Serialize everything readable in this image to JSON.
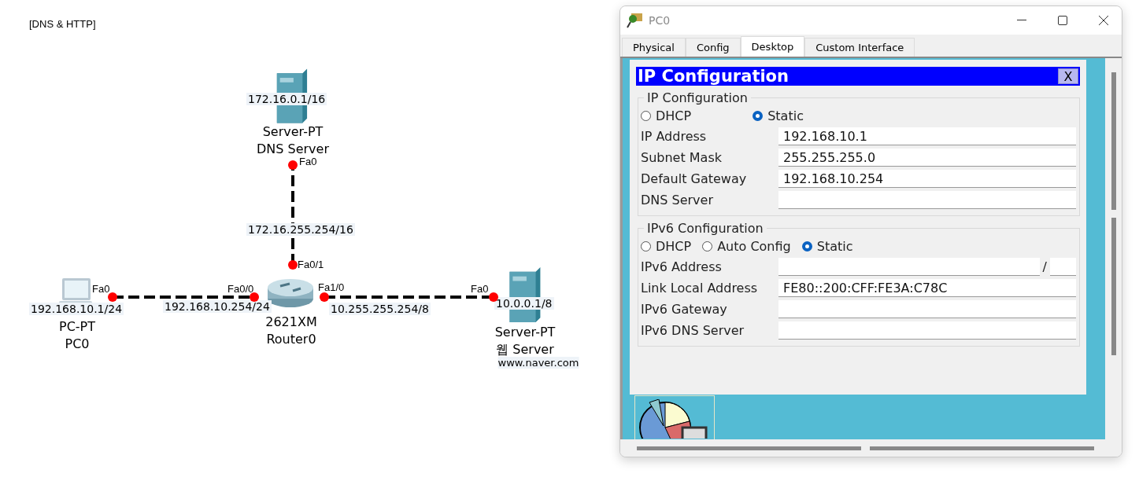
{
  "canvas": {
    "title": "[DNS & HTTP]",
    "devices": [
      {
        "kind": "server",
        "model": "Server-PT",
        "name": "DNS Server",
        "interfaces": [
          {
            "port": "Fa0",
            "address": "172.16.0.1/16"
          }
        ]
      },
      {
        "kind": "pc",
        "model": "PC-PT",
        "name": "PC0",
        "interfaces": [
          {
            "port": "Fa0",
            "address": "192.168.10.1/24"
          }
        ]
      },
      {
        "kind": "router",
        "model": "2621XM",
        "name": "Router0",
        "interfaces": [
          {
            "port": "Fa0/0",
            "address": "192.168.10.254/24"
          },
          {
            "port": "Fa0/1",
            "address": "172.16.255.254/16"
          },
          {
            "port": "Fa1/0",
            "address": "10.255.255.254/8"
          }
        ]
      },
      {
        "kind": "server",
        "model": "Server-PT",
        "name": "웹 Server",
        "url": "www.naver.com",
        "interfaces": [
          {
            "port": "Fa0",
            "address": "10.0.0.1/8"
          }
        ]
      }
    ]
  },
  "window": {
    "title": "PC0",
    "tabs": [
      {
        "label": "Physical",
        "selected": false
      },
      {
        "label": "Config",
        "selected": false
      },
      {
        "label": "Desktop",
        "selected": true
      },
      {
        "label": "Custom Interface",
        "selected": false
      }
    ],
    "dialog": {
      "title": "IP Configuration",
      "close": "X",
      "sections": [
        {
          "legend": "IP Configuration",
          "modes": [
            {
              "label": "DHCP",
              "selected": false
            },
            {
              "label": "Static",
              "selected": true
            }
          ],
          "fields": [
            {
              "label": "IP Address",
              "value": "192.168.10.1"
            },
            {
              "label": "Subnet Mask",
              "value": "255.255.255.0"
            },
            {
              "label": "Default Gateway",
              "value": "192.168.10.254"
            },
            {
              "label": "DNS Server"
            }
          ]
        },
        {
          "legend": "IPv6 Configuration",
          "modes": [
            {
              "label": "DHCP",
              "selected": false
            },
            {
              "label": "Auto Config",
              "selected": false
            },
            {
              "label": "Static",
              "selected": true
            }
          ],
          "fields": [
            {
              "label": "IPv6 Address",
              "kind": "prefix",
              "separator": "/"
            },
            {
              "label": "Link Local Address",
              "value": "FE80::200:CFF:FE3A:C78C"
            },
            {
              "label": "IPv6 Gateway"
            },
            {
              "label": "IPv6 DNS Server"
            }
          ]
        }
      ]
    }
  }
}
